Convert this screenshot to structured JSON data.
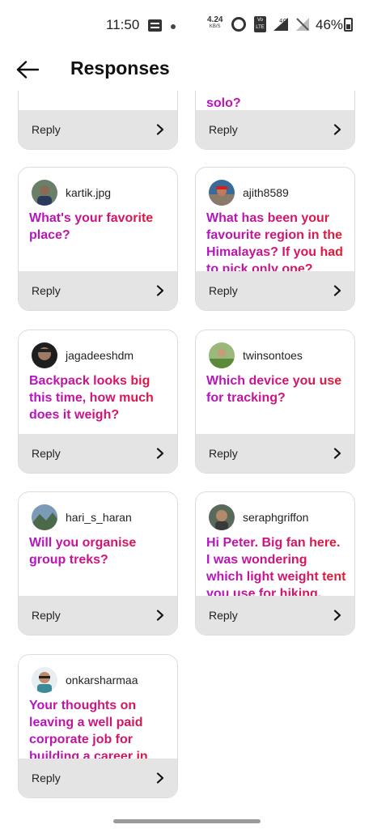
{
  "status_bar": {
    "time": "11:50",
    "net_speed": "4.24",
    "net_unit": "KB/S",
    "volte": "Vo LTE",
    "network_type": "4G",
    "battery": "46%"
  },
  "header": {
    "title": "Responses"
  },
  "reply_label": "Reply",
  "partial_cards": [
    {
      "question": ""
    },
    {
      "question": "solo?"
    }
  ],
  "cards": [
    {
      "username": "kartik.jpg",
      "question": "What's your favorite place?"
    },
    {
      "username": "ajith8589",
      "question": "What has been your favourite region in the Himalayas? If you had to pick only one?"
    },
    {
      "username": "jagadeeshdm",
      "question": "Backpack looks big this time, how much does it weigh?"
    },
    {
      "username": "twinsontoes",
      "question": "Which device you use for tracking?"
    },
    {
      "username": "hari_s_haran",
      "question": "Will you organise group treks?"
    },
    {
      "username": "seraphgriffon",
      "question": "Hi Peter. Big fan here. I was wondering which light weight tent you use for hiking."
    },
    {
      "username": "onkarsharmaa",
      "question": "Your thoughts on leaving a well paid corporate job for building a career in outdoors?"
    }
  ],
  "colors": {
    "accent_start": "#b414c8",
    "accent_end": "#e21c2c",
    "reply_bar": "#e4e4e4"
  }
}
